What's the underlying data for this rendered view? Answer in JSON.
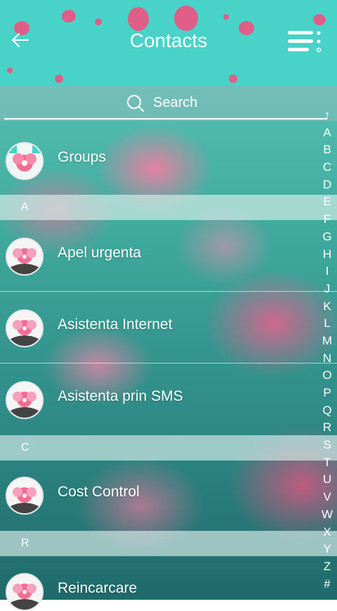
{
  "header": {
    "title": "Contacts",
    "back_icon": "arrow-left-icon",
    "menu_icon": "menu-icon",
    "bg_color": "#49d3c8"
  },
  "search": {
    "placeholder": "Search",
    "icon": "search-icon"
  },
  "list": {
    "groups": {
      "label": "Groups"
    },
    "section_a": "A",
    "items_a": [
      "Apel urgenta",
      "Asistenta Internet",
      "Asistenta prin SMS"
    ],
    "section_c": "C",
    "items_c": [
      "Cost Control"
    ],
    "section_r": "R",
    "items_r": [
      "Reincarcare"
    ]
  },
  "alphabet": [
    "↑",
    "A",
    "B",
    "C",
    "D",
    "E",
    "F",
    "G",
    "H",
    "I",
    "J",
    "K",
    "L",
    "M",
    "N",
    "O",
    "P",
    "Q",
    "R",
    "S",
    "T",
    "U",
    "V",
    "W",
    "X",
    "Y",
    "Z",
    "#"
  ],
  "colors": {
    "accent": "#49d3c8",
    "petal": "#f0517f"
  }
}
